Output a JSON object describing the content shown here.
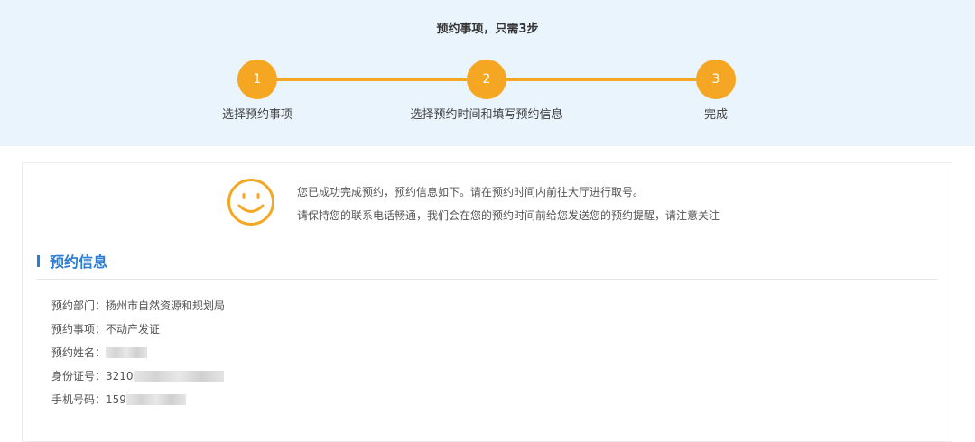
{
  "header": {
    "title": "预约事项，只需3步"
  },
  "steps": [
    {
      "num": "1",
      "label": "选择预约事项"
    },
    {
      "num": "2",
      "label": "选择预约时间和填写预约信息"
    },
    {
      "num": "3",
      "label": "完成"
    }
  ],
  "success": {
    "line1": "您已成功完成预约，预约信息如下。请在预约时间内前往大厅进行取号。",
    "line2": "请保持您的联系电话畅通，我们会在您的预约时间前给您发送您的预约提醒，请注意关注"
  },
  "section": {
    "title": "预约信息"
  },
  "info": [
    {
      "label": "预约部门：",
      "value": "扬州市自然资源和规划局"
    },
    {
      "label": "预约事项：",
      "value": "不动产发证"
    },
    {
      "label": "预约姓名：",
      "value": ""
    },
    {
      "label": "身份证号：",
      "value": "3210"
    },
    {
      "label": "手机号码：",
      "value": "159"
    }
  ],
  "colors": {
    "accent": "#f5a623",
    "blue": "#2b7cd3",
    "band": "#eaf4fd"
  }
}
